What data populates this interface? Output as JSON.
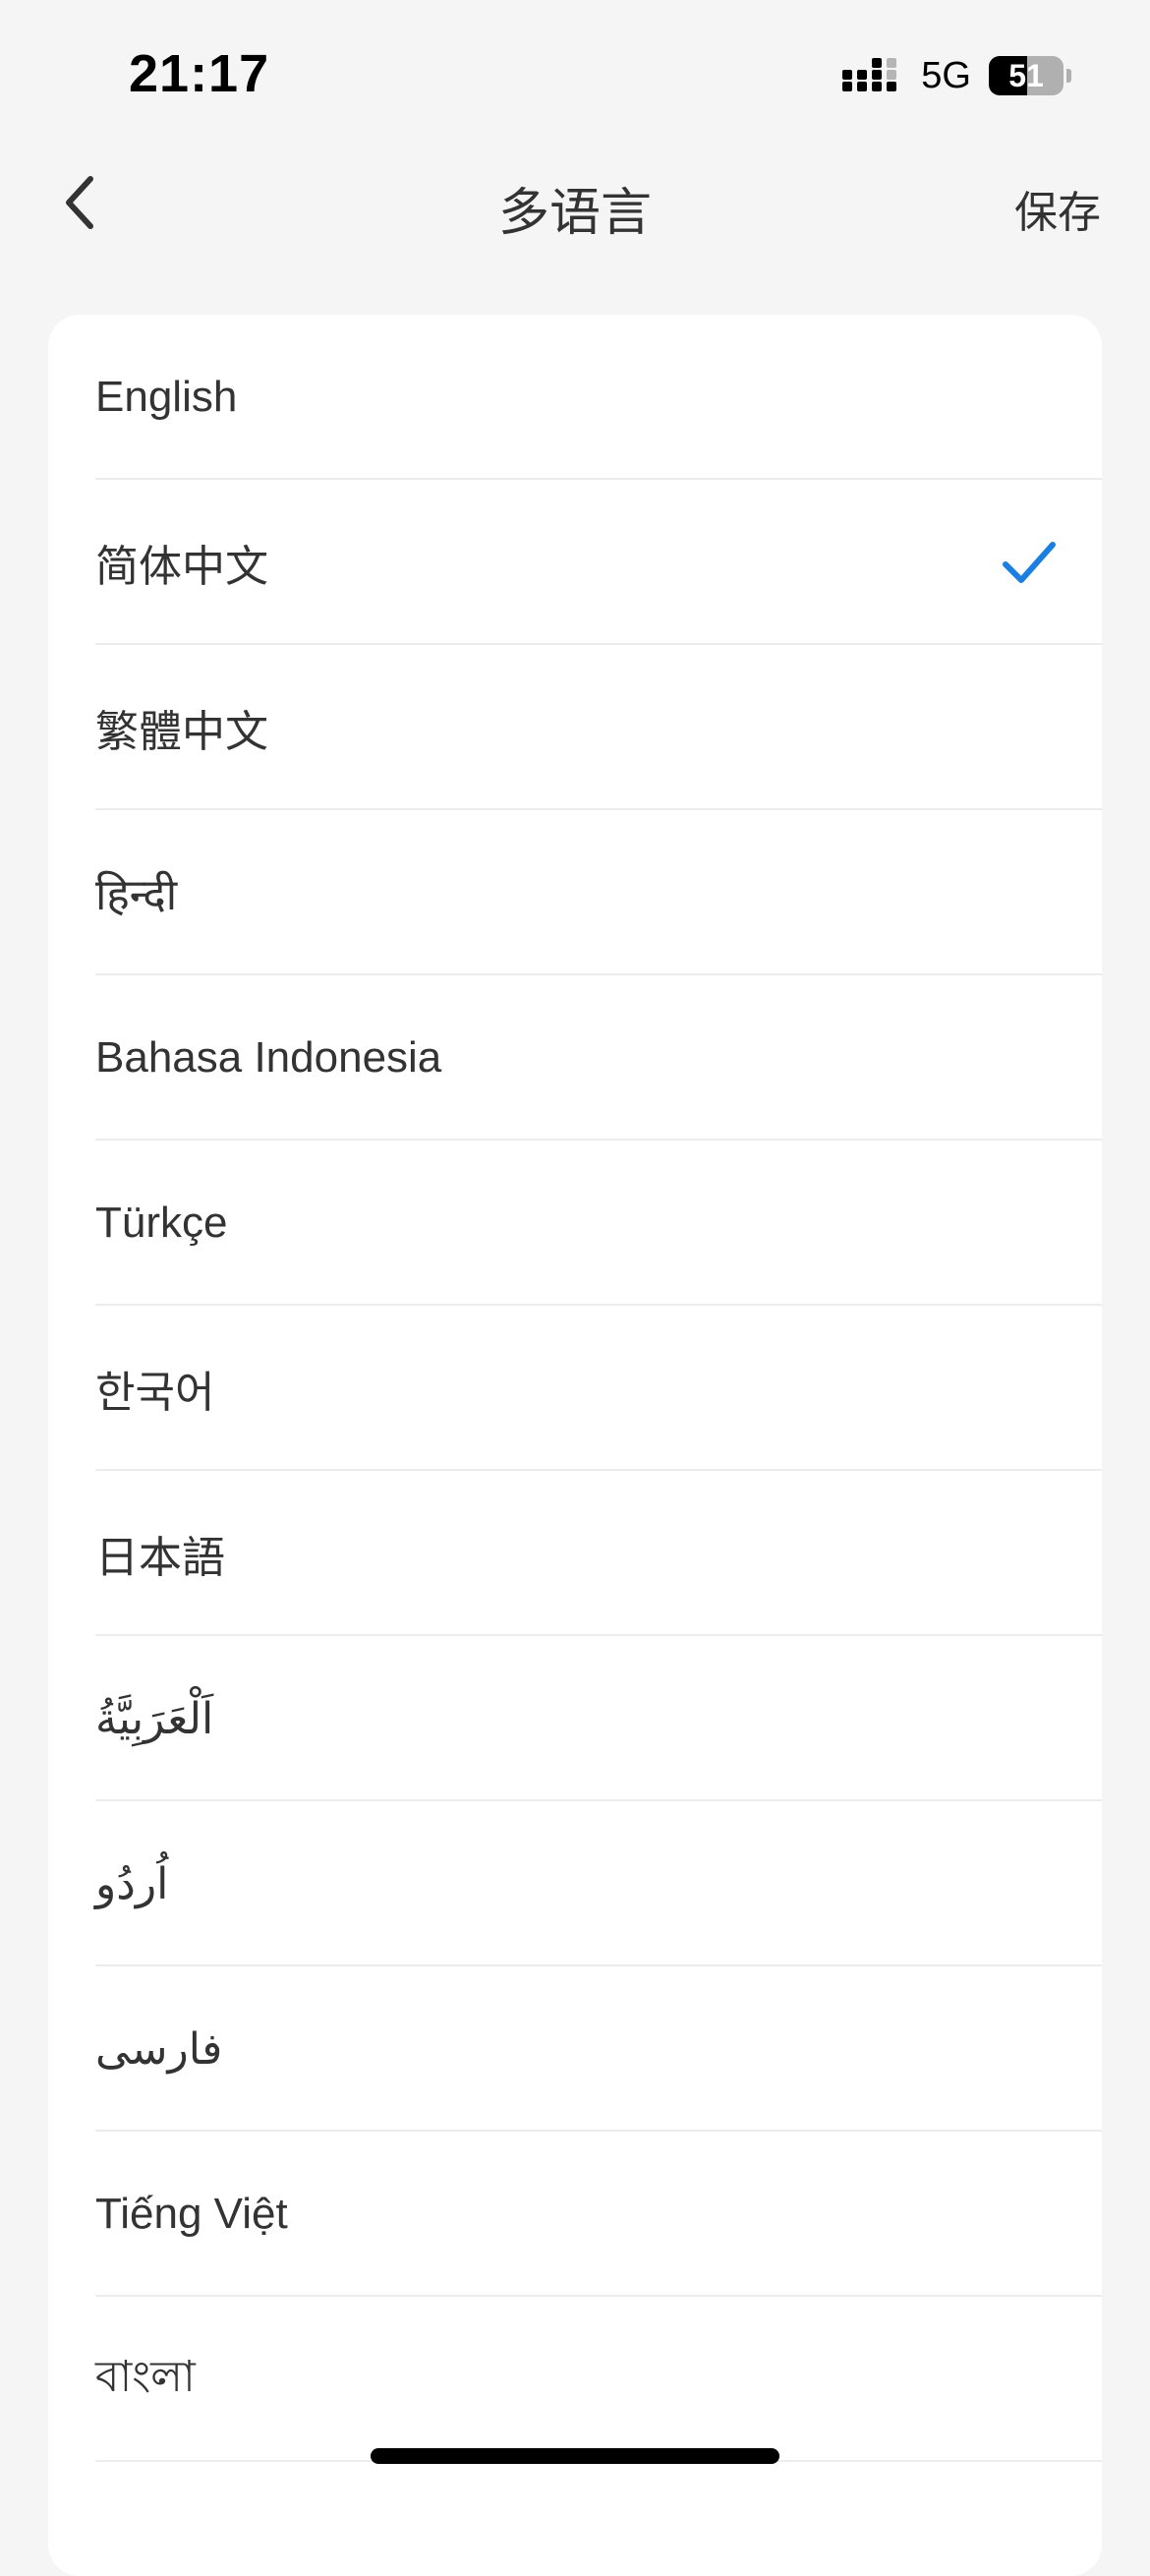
{
  "status_bar": {
    "time": "21:17",
    "network": "5G",
    "battery_percent": 51,
    "battery_label": "51",
    "signal_icon": "cellular-signal-icon",
    "battery_icon": "battery-icon"
  },
  "header": {
    "title": "多语言",
    "save_label": "保存",
    "back_icon": "chevron-left-icon"
  },
  "languages": [
    {
      "label": "English",
      "selected": false
    },
    {
      "label": "简体中文",
      "selected": true
    },
    {
      "label": "繁體中文",
      "selected": false
    },
    {
      "label": "हिन्दी",
      "selected": false
    },
    {
      "label": "Bahasa Indonesia",
      "selected": false
    },
    {
      "label": "Türkçe",
      "selected": false
    },
    {
      "label": "한국어",
      "selected": false
    },
    {
      "label": "日本語",
      "selected": false
    },
    {
      "label": "اَلْعَرَبِيَّةُ",
      "selected": false
    },
    {
      "label": "اُردُو",
      "selected": false
    },
    {
      "label": "فارسی",
      "selected": false
    },
    {
      "label": "Tiếng Việt",
      "selected": false
    },
    {
      "label": "বাংলা",
      "selected": false
    }
  ],
  "colors": {
    "background": "#f5f5f5",
    "card": "#ffffff",
    "text": "#333333",
    "accent_check": "#1a7fe0",
    "divider": "#ececec"
  },
  "selected_icon": "checkmark-icon"
}
